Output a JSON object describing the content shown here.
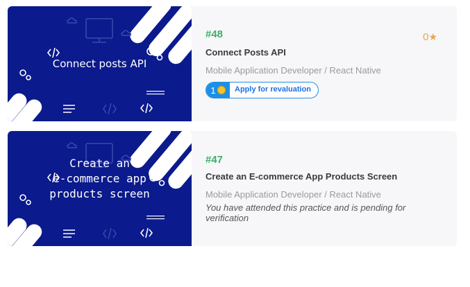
{
  "cards": [
    {
      "thumbnail_text": "Connect posts API",
      "number": "#48",
      "title": "Connect Posts API",
      "subtitle": "Mobile Application Developer / React Native",
      "score": "0",
      "score_icon": "star-icon",
      "apply_cost": "1",
      "apply_label": "Apply for revaluation"
    },
    {
      "thumbnail_text": "Create an\ne-commerce app\nproducts screen",
      "number": "#47",
      "title": "Create an E-commerce App Products Screen",
      "subtitle": "Mobile Application Developer / React Native",
      "status_note": "You have attended this practice and is pending for verification"
    }
  ],
  "colors": {
    "thumbnail_bg": "#0b1a8c",
    "number": "#3fae6a",
    "score": "#e6a74d",
    "button_accent": "#1e8fe6",
    "card_bg": "#f7f7f9"
  }
}
